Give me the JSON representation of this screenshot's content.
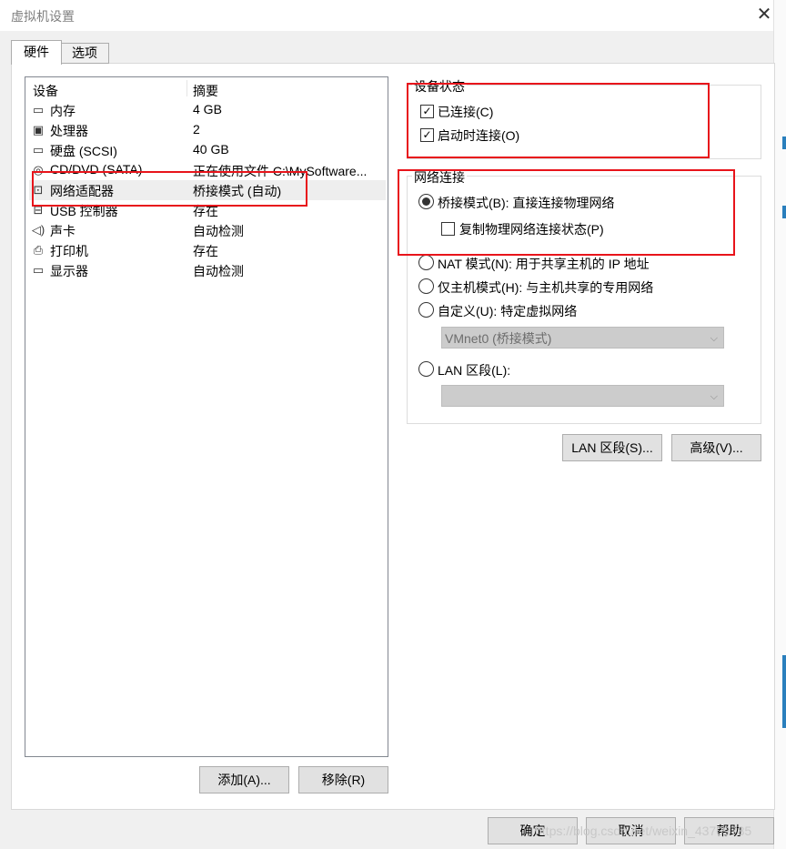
{
  "window": {
    "title": "虚拟机设置"
  },
  "tabs": [
    {
      "label": "硬件"
    },
    {
      "label": "选项"
    }
  ],
  "device_list": {
    "headers": {
      "device": "设备",
      "summary": "摘要"
    },
    "rows": [
      {
        "icon": "memory-icon",
        "name": "内存",
        "summary": "4 GB"
      },
      {
        "icon": "processor-icon",
        "name": "处理器",
        "summary": "2"
      },
      {
        "icon": "hard-disk-icon",
        "name": "硬盘 (SCSI)",
        "summary": "40 GB"
      },
      {
        "icon": "cd-dvd-icon",
        "name": "CD/DVD (SATA)",
        "summary": "正在使用文件 C:\\MySoftware..."
      },
      {
        "icon": "network-adapter-icon",
        "name": "网络适配器",
        "summary": "桥接模式 (自动)"
      },
      {
        "icon": "usb-icon",
        "name": "USB 控制器",
        "summary": "存在"
      },
      {
        "icon": "sound-icon",
        "name": "声卡",
        "summary": "自动检测"
      },
      {
        "icon": "printer-icon",
        "name": "打印机",
        "summary": "存在"
      },
      {
        "icon": "display-icon",
        "name": "显示器",
        "summary": "自动检测"
      }
    ],
    "selected": "网络适配器"
  },
  "list_buttons": {
    "add": "添加(A)...",
    "remove": "移除(R)"
  },
  "device_status": {
    "title": "设备状态",
    "connected": {
      "label": "已连接(C)",
      "checked": true
    },
    "connect_at_power_on": {
      "label": "启动时连接(O)",
      "checked": true
    }
  },
  "network_connection": {
    "title": "网络连接",
    "bridged": {
      "label": "桥接模式(B): 直接连接物理网络",
      "selected": true
    },
    "replicate_state": {
      "label": "复制物理网络连接状态(P)",
      "checked": false
    },
    "nat": {
      "label": "NAT 模式(N): 用于共享主机的 IP 地址",
      "selected": false
    },
    "host_only": {
      "label": "仅主机模式(H): 与主机共享的专用网络",
      "selected": false
    },
    "custom": {
      "label": "自定义(U): 特定虚拟网络",
      "selected": false,
      "combo_value": "VMnet0 (桥接模式)"
    },
    "lan_segment": {
      "label": "LAN 区段(L):",
      "selected": false,
      "combo_value": ""
    }
  },
  "adapter_buttons": {
    "lan_segments": "LAN 区段(S)...",
    "advanced": "高级(V)..."
  },
  "dialog_buttons": {
    "ok": "确定",
    "cancel": "取消",
    "help": "帮助"
  },
  "watermark": "https://blog.csdn.net/weixin_43709785",
  "colors": {
    "highlight_box": "#e8141b",
    "selected_row": "#eeeeee"
  }
}
